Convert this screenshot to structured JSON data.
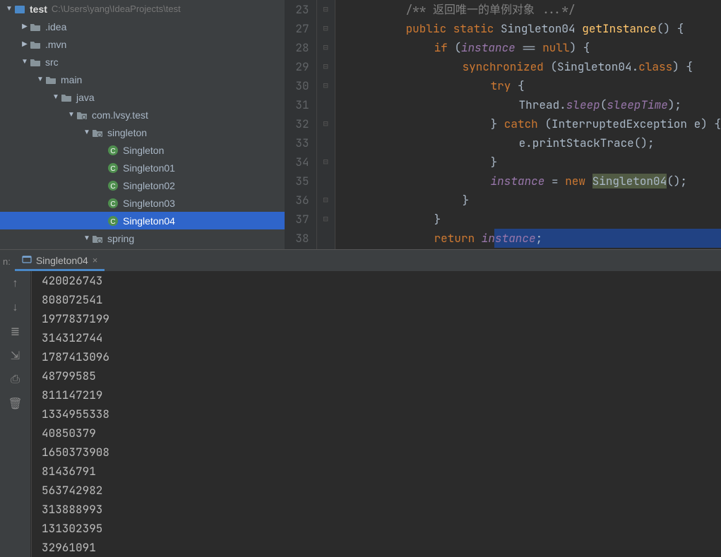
{
  "project": {
    "name": "test",
    "path": "C:\\Users\\yang\\IdeaProjects\\test"
  },
  "tree": [
    {
      "depth": 0,
      "arrow": "down",
      "icon": "module",
      "label": "test",
      "sublabel": "C:\\Users\\yang\\IdeaProjects\\test"
    },
    {
      "depth": 1,
      "arrow": "right",
      "icon": "folder",
      "label": ".idea"
    },
    {
      "depth": 1,
      "arrow": "right",
      "icon": "folder",
      "label": ".mvn"
    },
    {
      "depth": 1,
      "arrow": "down",
      "icon": "folder",
      "label": "src"
    },
    {
      "depth": 2,
      "arrow": "down",
      "icon": "folder",
      "label": "main"
    },
    {
      "depth": 3,
      "arrow": "down",
      "icon": "folder",
      "label": "java"
    },
    {
      "depth": 4,
      "arrow": "down",
      "icon": "package",
      "label": "com.lvsy.test"
    },
    {
      "depth": 5,
      "arrow": "down",
      "icon": "package",
      "label": "singleton"
    },
    {
      "depth": 6,
      "arrow": "",
      "icon": "class",
      "label": "Singleton"
    },
    {
      "depth": 6,
      "arrow": "",
      "icon": "class",
      "label": "Singleton01"
    },
    {
      "depth": 6,
      "arrow": "",
      "icon": "class",
      "label": "Singleton02"
    },
    {
      "depth": 6,
      "arrow": "",
      "icon": "class",
      "label": "Singleton03"
    },
    {
      "depth": 6,
      "arrow": "",
      "icon": "class",
      "label": "Singleton04",
      "selected": true
    },
    {
      "depth": 5,
      "arrow": "down",
      "icon": "package",
      "label": "spring"
    }
  ],
  "editor": {
    "lines": [
      {
        "num": 23,
        "mark": "⊟",
        "tokens": [
          {
            "t": "/** 返回唯一的单例对象 ...*/",
            "c": "tk-comment",
            "indent": 8
          }
        ]
      },
      {
        "num": 27,
        "mark": "⊟",
        "tokens": [
          {
            "t": "public",
            "c": "tk-kw",
            "indent": 8
          },
          {
            "t": " "
          },
          {
            "t": "static",
            "c": "tk-kw"
          },
          {
            "t": " "
          },
          {
            "t": "Singleton04",
            "c": "tk-type"
          },
          {
            "t": " "
          },
          {
            "t": "getInstance",
            "c": "tk-method"
          },
          {
            "t": "() {",
            "c": "tk-punct"
          }
        ]
      },
      {
        "num": 28,
        "mark": "⊟",
        "tokens": [
          {
            "t": "if",
            "c": "tk-kw",
            "indent": 12
          },
          {
            "t": " (",
            "c": "tk-punct"
          },
          {
            "t": "instance",
            "c": "tk-field"
          },
          {
            "t": " == ",
            "c": "tk-punct"
          },
          {
            "t": "null",
            "c": "tk-kw"
          },
          {
            "t": ") {",
            "c": "tk-punct"
          }
        ]
      },
      {
        "num": 29,
        "mark": "⊟",
        "tokens": [
          {
            "t": "synchronized",
            "c": "tk-kw",
            "indent": 16
          },
          {
            "t": " (Singleton04.",
            "c": "tk-punct"
          },
          {
            "t": "class",
            "c": "tk-kw"
          },
          {
            "t": ") {",
            "c": "tk-punct"
          }
        ]
      },
      {
        "num": 30,
        "mark": "⊟",
        "tokens": [
          {
            "t": "try",
            "c": "tk-kw",
            "indent": 20
          },
          {
            "t": " {",
            "c": "tk-punct"
          }
        ]
      },
      {
        "num": 31,
        "mark": "",
        "tokens": [
          {
            "t": "Thread.",
            "c": "tk-punct",
            "indent": 24
          },
          {
            "t": "sleep",
            "c": "tk-field"
          },
          {
            "t": "(",
            "c": "tk-punct"
          },
          {
            "t": "sleepTime",
            "c": "tk-field"
          },
          {
            "t": ");",
            "c": "tk-punct"
          }
        ]
      },
      {
        "num": 32,
        "mark": "⊟",
        "tokens": [
          {
            "t": "} ",
            "c": "tk-punct",
            "indent": 20
          },
          {
            "t": "catch",
            "c": "tk-kw"
          },
          {
            "t": " (InterruptedException e) {",
            "c": "tk-punct"
          }
        ]
      },
      {
        "num": 33,
        "mark": "",
        "tokens": [
          {
            "t": "e.printStackTrace();",
            "c": "tk-punct",
            "indent": 24
          }
        ]
      },
      {
        "num": 34,
        "mark": "⊟",
        "tokens": [
          {
            "t": "}",
            "c": "tk-punct",
            "indent": 20
          }
        ]
      },
      {
        "num": 35,
        "mark": "",
        "tokens": [
          {
            "t": "instance",
            "c": "tk-field",
            "indent": 20
          },
          {
            "t": " = ",
            "c": "tk-punct"
          },
          {
            "t": "new",
            "c": "tk-kw"
          },
          {
            "t": " "
          },
          {
            "t": "Singleton04",
            "c": "tk-type tk-hl"
          },
          {
            "t": "();",
            "c": "tk-punct"
          }
        ]
      },
      {
        "num": 36,
        "mark": "⊟",
        "tokens": [
          {
            "t": "}",
            "c": "tk-punct",
            "indent": 16
          }
        ]
      },
      {
        "num": 37,
        "mark": "⊟",
        "tokens": [
          {
            "t": "}",
            "c": "tk-punct",
            "indent": 12
          }
        ]
      },
      {
        "num": 38,
        "mark": "",
        "tokens": [
          {
            "t": "return",
            "c": "tk-kw",
            "indent": 12
          },
          {
            "t": " "
          },
          {
            "t": "instance",
            "c": "tk-field"
          },
          {
            "t": ";",
            "c": "tk-punct"
          }
        ],
        "sel_after": true
      }
    ]
  },
  "console": {
    "tab_label": "Singleton04",
    "tab_prefix": "n:",
    "output": [
      "420026743",
      "808072541",
      "1977837199",
      "314312744",
      "1787413096",
      "48799585",
      "811147219",
      "1334955338",
      "40850379",
      "1650373908",
      "81436791",
      "563742982",
      "313888993",
      "131302395",
      "32961091"
    ]
  },
  "icons": {
    "arrow_up": "↑",
    "arrow_down": "↓",
    "wrap": "≣",
    "scroll": "⇲",
    "print": "⎙",
    "trash": "🗑"
  }
}
